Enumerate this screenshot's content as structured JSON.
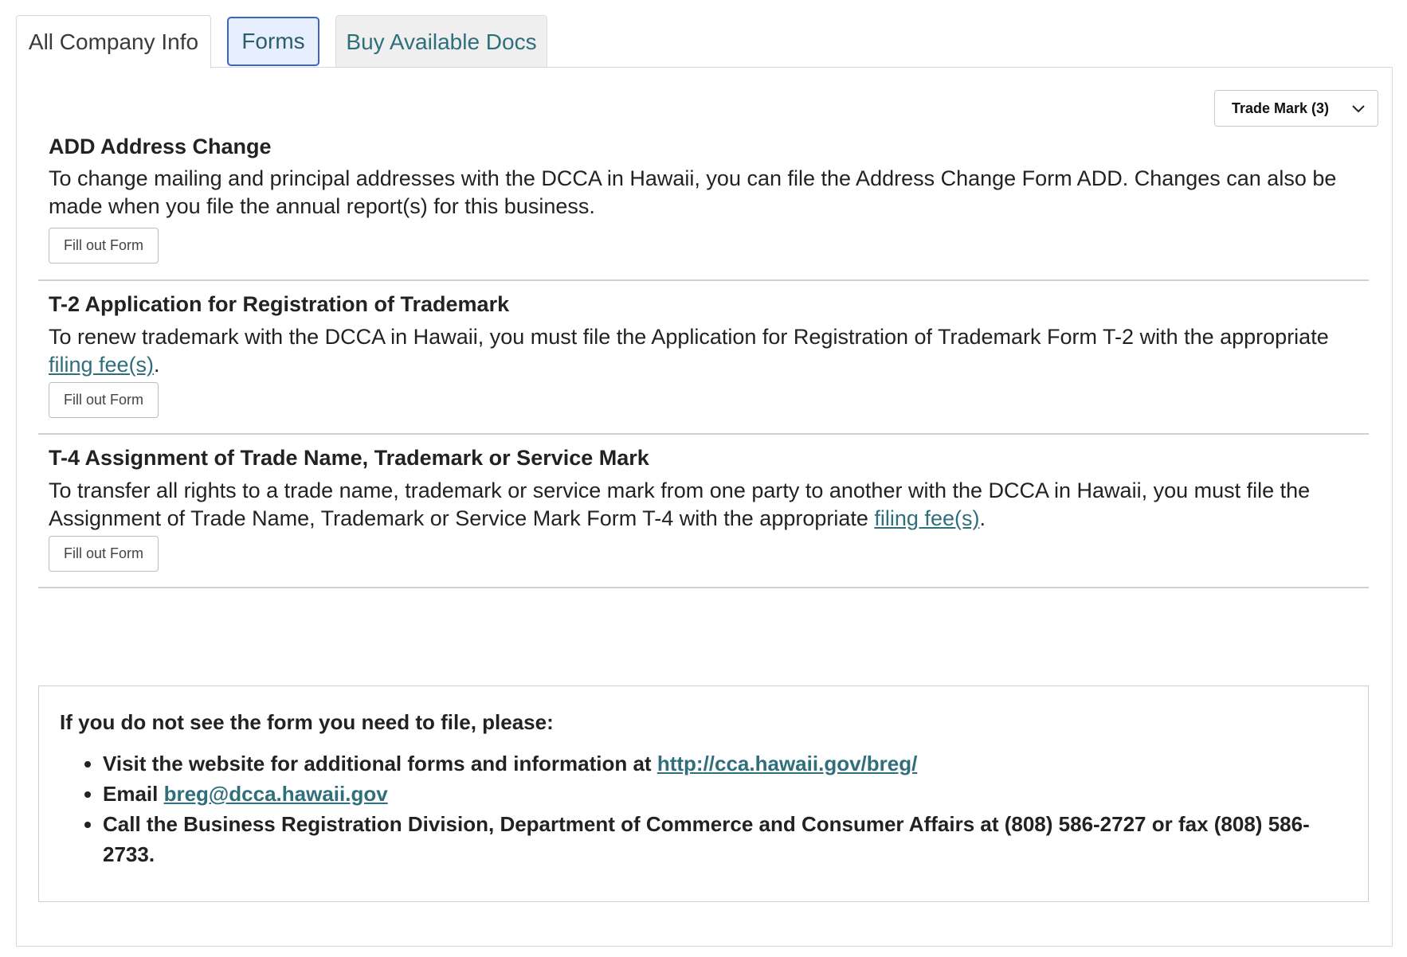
{
  "tabs": {
    "company_info": "All Company Info",
    "forms": "Forms",
    "buy_docs": "Buy Available Docs"
  },
  "filter": {
    "selected": "Trade Mark (3)"
  },
  "forms": [
    {
      "title": "ADD Address Change",
      "description": "To change mailing and principal addresses with the DCCA in Hawaii, you can file the Address Change Form ADD. Changes can also be made when you file the annual report(s) for this business.",
      "button": "Fill out Form"
    },
    {
      "title": "T-2 Application for Registration of Trademark",
      "description": "To renew trademark with the DCCA in Hawaii, you must file the Application for Registration of Trademark Form T-2 with the appropriate ",
      "link": "filing fee(s)",
      "suffix": ".",
      "button": "Fill out Form"
    },
    {
      "title": "T-4 Assignment of Trade Name, Trademark or Service Mark",
      "description": "To transfer all rights to a trade name, trademark or service mark from one party to another with the DCCA in Hawaii, you must file the Assignment of Trade Name, Trademark or Service Mark Form T-4 with the appropriate ",
      "link": "filing fee(s)",
      "suffix": ".",
      "button": "Fill out Form"
    }
  ],
  "help": {
    "heading": "If you do not see the form you need to file, please:",
    "visit_prefix": "Visit the website for additional forms and information at ",
    "visit_link": "http://cca.hawaii.gov/breg/",
    "email_prefix": "Email ",
    "email_link": "breg@dcca.hawaii.gov",
    "call": "Call the Business Registration Division, Department of Commerce and Consumer Affairs at (808) 586-2727 or fax (808) 586-2733."
  }
}
